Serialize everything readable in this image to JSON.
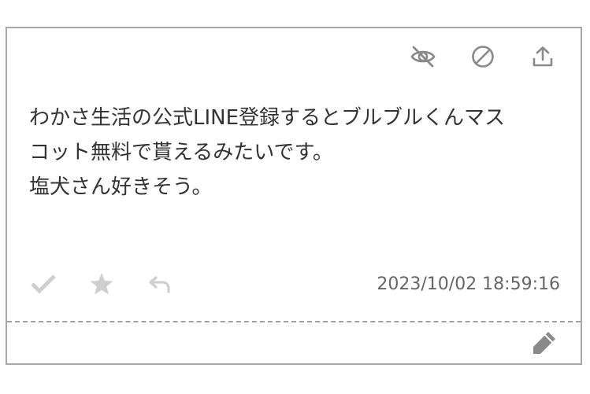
{
  "post": {
    "message": "わかさ生活の公式LINE登録するとブルブルくんマス\nコット無料で貰えるみたいです。\n塩犬さん好きそう。",
    "timestamp": "2023/10/02 18:59:16"
  },
  "icons": {
    "hide": "eye-slash-icon",
    "block": "ban-icon",
    "share": "upload-icon",
    "check": "check-icon",
    "star": "star-icon",
    "reply": "reply-icon",
    "edit": "pencil-icon"
  },
  "colors": {
    "icon_dark": "#8a8a8a",
    "icon_light": "#cfcfcf",
    "border": "#a8a8a8",
    "text": "#333333"
  }
}
